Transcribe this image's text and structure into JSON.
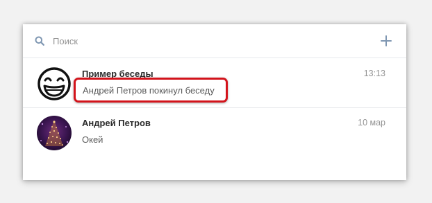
{
  "search": {
    "placeholder": "Поиск"
  },
  "conversations": [
    {
      "title": "Пример беседы",
      "time": "13:13",
      "preview": "Андрей Петров покинул беседу",
      "avatar_icon": "grinning-face-icon",
      "highlighted": true
    },
    {
      "title": "Андрей Петров",
      "time": "10 мар",
      "preview": "Окей",
      "avatar_icon": "christmas-tree-photo"
    }
  ],
  "colors": {
    "highlight_border": "#d3131b",
    "icon_blue": "#7f97b2",
    "divider": "#e7e8ec"
  }
}
